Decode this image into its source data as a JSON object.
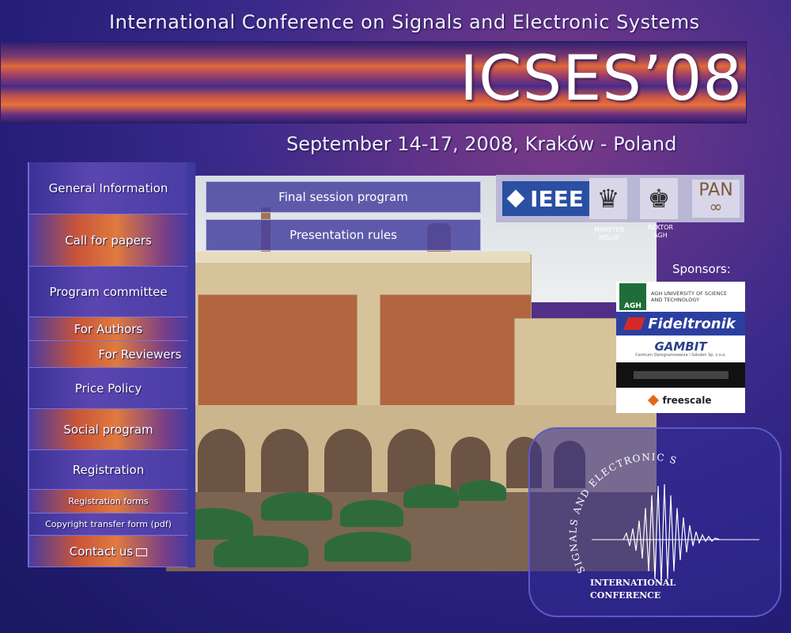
{
  "header": {
    "conference_title": "International Conference on Signals and Electronic Systems",
    "acronym": "ICSES’08",
    "dates_location": "September 14-17, 2008, Kraków - Poland"
  },
  "nav": {
    "general_information": "General Information",
    "call_for_papers": "Call for papers",
    "program_committee": "Program committee",
    "for_authors": "For Authors",
    "for_reviewers": "For Reviewers",
    "price_policy": "Price Policy",
    "social_program": "Social program",
    "registration": "Registration",
    "registration_forms": "Registration forms",
    "copyright_form": "Copyright transfer form (pdf)",
    "contact_us": "Contact us"
  },
  "buttons": {
    "final_session_program": "Final session program",
    "presentation_rules": "Presentation rules"
  },
  "logos": {
    "ieee": "IEEE",
    "minister_caption": "MINISTER NISzW",
    "rektor_caption": "REKTOR AGH",
    "pan": "PAN"
  },
  "sponsors": {
    "label": "Sponsors:",
    "agh_line1": "AGH UNIVERSITY OF SCIENCE",
    "agh_line2": "AND TECHNOLOGY",
    "agh_mark": "AGH",
    "fideltronik": "Fideltronik",
    "gambit": "GAMBIT",
    "gambit_sub": "Centrum Oprogramowania i Szkoleń Sp. z o.o.",
    "freescale": "freescale"
  },
  "emblem": {
    "arc_text": "SIGNALS AND ELECTRONIC SYSTEMS",
    "line1": "INTERNATIONAL",
    "line2": "CONFERENCE"
  },
  "colors": {
    "background": "#2a2280",
    "sidebar": "#3e3a9e",
    "accent_orange": "#e0683a",
    "ieee_blue": "#2a4fa3"
  }
}
